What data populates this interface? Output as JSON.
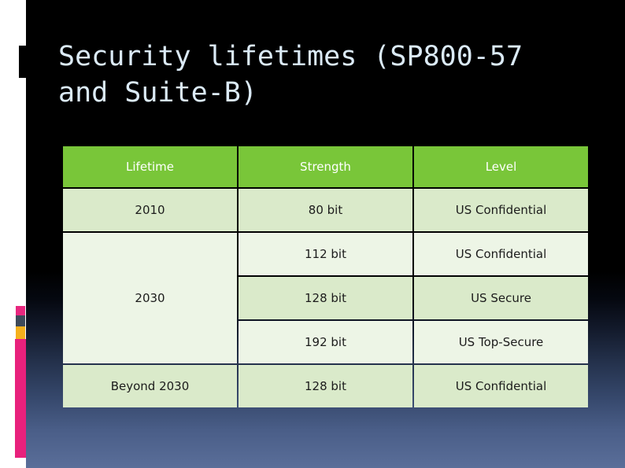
{
  "slide": {
    "title": "Security lifetimes (SP800-57 and Suite-B)",
    "background_top_color": "#000000",
    "background_bottom_color": "#5a6e99",
    "title_color": "#dbeaf6"
  },
  "decoration": {
    "rail_color": "#ffffff",
    "chip_pink": "#e8277f",
    "chip_slate": "#3e4a5a",
    "chip_gold": "#f5b01c",
    "bar_pink": "#e8217c",
    "block_black": "#000000"
  },
  "table": {
    "header_color": "#79c639",
    "header_text_color": "#ffffff",
    "row_dark_color": "#daeaca",
    "row_light_color": "#edf5e6",
    "columns": [
      "Lifetime",
      "Strength",
      "Level"
    ],
    "rows": [
      {
        "lifetime": "2010",
        "strength": "80 bit",
        "level": "US Confidential"
      },
      {
        "lifetime": "",
        "strength": "112 bit",
        "level": "US Confidential"
      },
      {
        "lifetime": "2030",
        "strength": "128 bit",
        "level": "US Secure"
      },
      {
        "lifetime": "",
        "strength": "192 bit",
        "level": "US Top-Secure"
      },
      {
        "lifetime": "Beyond 2030",
        "strength": "128 bit",
        "level": "US Confidential"
      }
    ]
  }
}
